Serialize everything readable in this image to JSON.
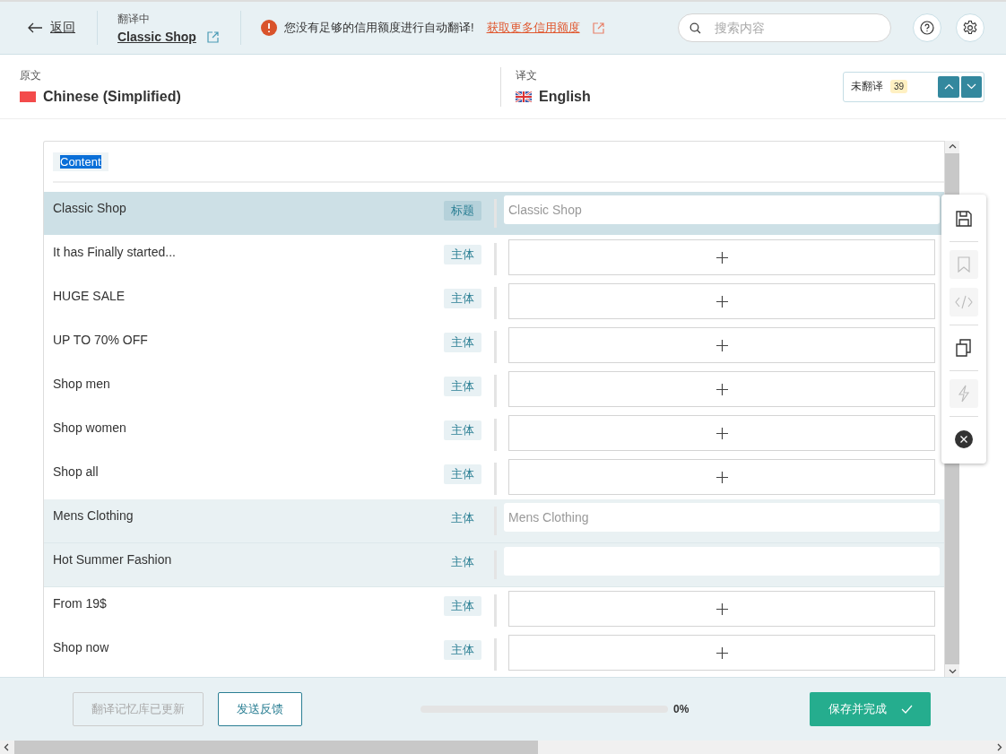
{
  "header": {
    "back": "返回",
    "context_label": "翻译中",
    "project": "Classic Shop",
    "warning": "您没有足够的信用额度进行自动翻译!",
    "warning_link": "获取更多信用额度",
    "search": {
      "placeholder": "搜索内容"
    }
  },
  "languages": {
    "source_label": "原文",
    "source": "Chinese (Simplified)",
    "target_label": "译文",
    "target": "English"
  },
  "filter": {
    "label": "未翻译",
    "count": "39"
  },
  "section": {
    "title": "Content",
    "highlighted": true
  },
  "rows": [
    {
      "source": "Classic Shop",
      "tag": "标题",
      "selected": true,
      "translated": false,
      "value": "Classic Shop"
    },
    {
      "source": "It has Finally started...",
      "tag": "主体",
      "selected": false,
      "translated": false
    },
    {
      "source": "HUGE SALE",
      "tag": "主体",
      "selected": false,
      "translated": false
    },
    {
      "source": "UP TO 70% OFF",
      "tag": "主体",
      "selected": false,
      "translated": false
    },
    {
      "source": "Shop men",
      "tag": "主体",
      "selected": false,
      "translated": false
    },
    {
      "source": "Shop women",
      "tag": "主体",
      "selected": false,
      "translated": false
    },
    {
      "source": "Shop all",
      "tag": "主体",
      "selected": false,
      "translated": false
    },
    {
      "source": "Mens Clothing",
      "tag": "主体",
      "selected": false,
      "translated": true,
      "value": "Mens Clothing"
    },
    {
      "source": "Hot Summer Fashion",
      "tag": "主体",
      "selected": false,
      "translated": true
    },
    {
      "source": "From 19$",
      "tag": "主体",
      "selected": false,
      "translated": false
    },
    {
      "source": "Shop now",
      "tag": "主体",
      "selected": false,
      "translated": false
    }
  ],
  "toolbar": [
    {
      "kind": "save",
      "disabled": false
    },
    {
      "kind": "bookmark",
      "disabled": true
    },
    {
      "kind": "code",
      "disabled": true
    },
    {
      "kind": "copy",
      "disabled": false
    },
    {
      "kind": "lightning",
      "disabled": true
    },
    {
      "kind": "close",
      "disabled": false
    }
  ],
  "footer": {
    "memory_button": {
      "label": "翻译记忆库已更新",
      "disabled": true
    },
    "feedback_button": "发送反馈",
    "progress": {
      "level": 0,
      "reading": "0%"
    },
    "save_button": "保存并完成"
  }
}
